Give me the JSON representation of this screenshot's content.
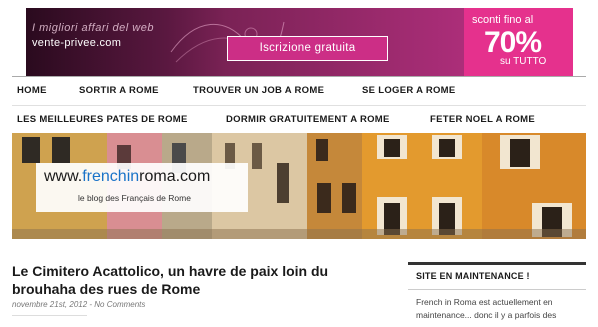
{
  "ad_banner": {
    "tagline": "I migliori affari del web",
    "brand": "vente-privee.com",
    "cta": "Iscrizione gratuita",
    "promo_line1": "sconti fino al",
    "promo_line2": "70%",
    "promo_line3": "su TUTTO"
  },
  "nav": {
    "row1": [
      "HOME",
      "SORTIR A ROME",
      "TROUVER UN JOB A ROME",
      "SE LOGER A ROME"
    ],
    "row2": [
      "LES MEILLEURES PATES DE ROME",
      "DORMIR GRATUITEMENT A ROME",
      "FETER NOEL A ROME"
    ]
  },
  "header": {
    "logo_prefix": "www.",
    "logo_accent": "frenchin",
    "logo_suffix": "roma.com",
    "logo_subtitle": "le blog des Français de Rome"
  },
  "post": {
    "title": "Le Cimitero Acattolico, un havre de paix loin du brouhaha des rues de Rome",
    "date": "novembre 21st, 2012",
    "comments": "No Comments"
  },
  "sidebar": {
    "widget_title": "SITE EN MAINTENANCE !",
    "widget_text": "French in Roma est actuellement en maintenance... donc il y a parfois des"
  }
}
